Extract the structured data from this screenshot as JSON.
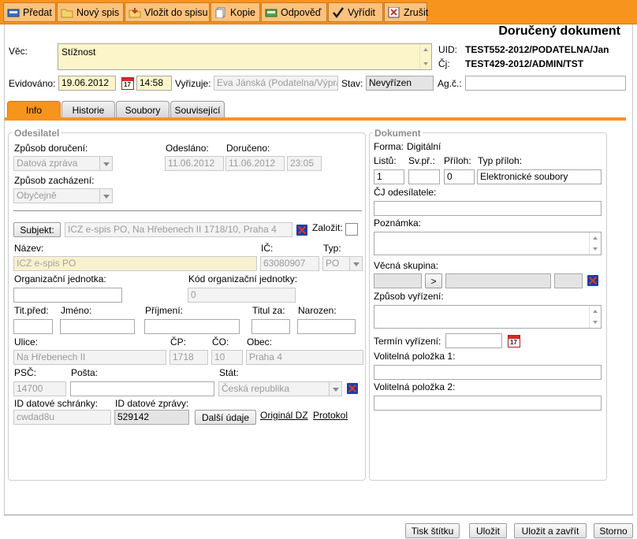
{
  "toolbar": {
    "predat": "Předat",
    "novy_spis": "Nový spis",
    "vlozit": "Vložit do spisu",
    "kopie": "Kopie",
    "odpoved": "Odpověď",
    "vyridit": "Vyřídit",
    "zrusit": "Zrušit"
  },
  "header": {
    "title": "Doručený dokument",
    "vec_label": "Věc:",
    "vec_value": "Stížnost",
    "uid_label": "UID:",
    "uid_value": "TEST552-2012/PODATELNA/Jan",
    "cj_label": "Čj:",
    "cj_value": "TEST429-2012/ADMIN/TST",
    "evidovano_label": "Evidováno:",
    "evidovano_date": "19.06.2012",
    "evidovano_time": "14:58",
    "vyrizuje_label": "Vyřizuje:",
    "vyrizuje_value": "Eva Jánská (Podatelna/Výprava)",
    "stav_label": "Stav:",
    "stav_value": "Nevyřízen",
    "agc_label": "Ag.č.:",
    "agc_value": ""
  },
  "tabs": [
    "Info",
    "Historie",
    "Soubory",
    "Související"
  ],
  "odesilatel": {
    "legend": "Odesilatel",
    "zpusob_doruceni_label": "Způsob doručení:",
    "zpusob_doruceni_value": "Datová zpráva",
    "odeslano_label": "Odesláno:",
    "odeslano_value": "11.06.2012",
    "doruceno_label": "Doručeno:",
    "doruceno_date": "11.06.2012",
    "doruceno_time": "23:05",
    "zpusob_zachazeni_label": "Způsob zacházení:",
    "zpusob_zachazeni_value": "Obyčejně",
    "subjekt_button": "Subjekt:",
    "subjekt_value": "ICZ e-spis PO, Na Hřebenech II 1718/10, Praha 4",
    "zalozit_label": "Založit:",
    "nazev_label": "Název:",
    "nazev_value": "ICZ e-spis PO",
    "ic_label": "IČ:",
    "ic_value": "63080907",
    "typ_label": "Typ:",
    "typ_value": "PO",
    "org_jednotka_label": "Organizační jednotka:",
    "org_jednotka_value": "",
    "kod_org_label": "Kód organizační jednotky:",
    "kod_org_value": "0",
    "tit_pred_label": "Tit.před:",
    "jmeno_label": "Jméno:",
    "prijmeni_label": "Příjmení:",
    "titul_za_label": "Titul za:",
    "narozen_label": "Narozen:",
    "ulice_label": "Ulice:",
    "ulice_value": "Na Hřebenech II",
    "cp_label": "ČP:",
    "cp_value": "1718",
    "co_label": "ČO:",
    "co_value": "10",
    "obec_label": "Obec:",
    "obec_value": "Praha 4",
    "psc_label": "PSČ:",
    "psc_value": "14700",
    "posta_label": "Pošta:",
    "posta_value": "",
    "stat_label": "Stát:",
    "stat_value": "Česká republika",
    "id_schranky_label": "ID datové schránky:",
    "id_schranky_value": "cwdad8u",
    "id_zpravy_label": "ID datové zprávy:",
    "id_zpravy_value": "529142",
    "dalsi_udaje": "Další údaje",
    "original_dz": "Originál DZ",
    "protokol": "Protokol"
  },
  "dokument": {
    "legend": "Dokument",
    "forma_label": "Forma:",
    "forma_value": "Digitální",
    "listu_label": "Listů:",
    "listu_value": "1",
    "svpr_label": "Sv.př.:",
    "svpr_value": "",
    "priloh_label": "Příloh:",
    "priloh_value": "0",
    "typ_priloh_label": "Typ příloh:",
    "typ_priloh_value": "Elektronické soubory",
    "cj_odesilatele_label": "ČJ odesílatele:",
    "poznamka_label": "Poznámka:",
    "vecna_skupina_label": "Věcná skupina:",
    "vecna_button": ">",
    "zpusob_vyrizeni_label": "Způsob vyřízení:",
    "termin_label": "Termín vyřízení:",
    "volitelna1_label": "Volitelná položka 1:",
    "volitelna2_label": "Volitelná položka 2:"
  },
  "footer": {
    "tisk": "Tisk štítku",
    "ulozit": "Uložit",
    "ulozit_zavrit": "Uložit a zavřít",
    "storno": "Storno"
  },
  "colors": {
    "toolbar": "#f7941d",
    "toolbar_button": "#fbc27e",
    "required_field": "#fbf5c9"
  }
}
